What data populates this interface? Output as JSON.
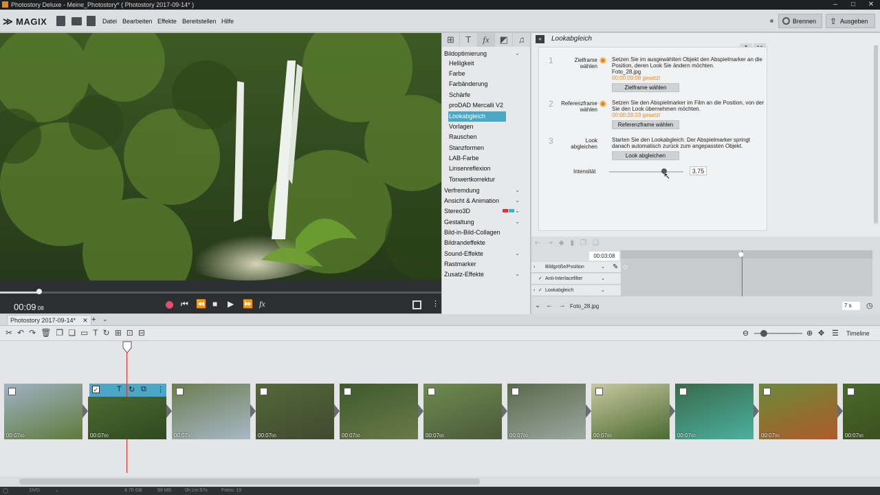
{
  "window": {
    "title": "Photostory Deluxe - Meine_Photostory* ( Photostory 2017-09-14* )",
    "min": "–",
    "max": "□",
    "close": "✕"
  },
  "menu": {
    "brand": "MAGIX",
    "items": [
      "Datei",
      "Bearbeiten",
      "Effekte",
      "Bereitstellen",
      "Hilfe"
    ],
    "burn_label": "Brennen",
    "export_label": "Ausgeben"
  },
  "preview": {
    "timecode": "00:09",
    "timecode_frames": "08"
  },
  "effects": {
    "tabs": [
      "⊞",
      "T",
      "fx",
      "◩",
      "♫"
    ],
    "categories": [
      {
        "label": "Bildoptimierung",
        "expanded": true,
        "children": [
          "Helligkeit",
          "Farbe",
          "Farbänderung",
          "Schärfe",
          "proDAD Mercalli V2",
          "Lookabgleich",
          "Vorlagen",
          "Rauschen",
          "Stanzformen",
          "LAB-Farbe",
          "Linsenreflexion",
          "Tonwertkorrektur"
        ]
      },
      {
        "label": "Verfremdung"
      },
      {
        "label": "Ansicht & Animation"
      },
      {
        "label": "Stereo3D"
      },
      {
        "label": "Gestaltung"
      },
      {
        "label": "Bild-in-Bild-Collagen"
      },
      {
        "label": "Bildrandeffekte"
      },
      {
        "label": "Sound-Effekte"
      },
      {
        "label": "Rastmarker"
      },
      {
        "label": "Zusatz-Effekte"
      }
    ],
    "selected": "Lookabgleich"
  },
  "lookabgleich": {
    "title": "Lookabgleich",
    "step1": {
      "num": "1",
      "label1": "Zielframe",
      "label2": "wählen",
      "text": "Setzen Sie im ausgewählten Objekt den Abspielmarker an die Position, deren Look Sie ändern möchten.",
      "file": "Foto_28.jpg",
      "time": "00:00:09:08",
      "set": "gesetzt",
      "button": "Zielframe wählen"
    },
    "step2": {
      "num": "2",
      "label1": "Referenzframe",
      "label2": "wählen",
      "text": "Setzen Sie den Abspielmarker im Film an die Position, von der Sie den Look übernehmen möchten.",
      "time": "00:00:28:23",
      "set": "gesetzt",
      "button": "Referenzframe wählen"
    },
    "step3": {
      "num": "3",
      "label1": "Look",
      "label2": "abgleichen",
      "text": "Starten Sie den Lookabgleich. Der Abspielmarker springt danach automatisch zurück zum angepassten Objekt.",
      "button": "Look abgleichen"
    },
    "intensity_label": "Intensität",
    "intensity_value": "3.75",
    "intensity_fraction": 0.74
  },
  "keyframes": {
    "time": "00:03:08",
    "rows": [
      "Bildgröße/Position",
      "Anti-Interlacefilter",
      "Lookabgleich"
    ],
    "file": "Foto_28.jpg",
    "duration": "7 s"
  },
  "timeline": {
    "tab": "Photostory 2017-09-14*",
    "add": "+",
    "view_label": "Timeline",
    "clips": [
      {
        "dur": "00:07",
        "frames": "00",
        "colors": [
          "#9fb3c4",
          "#5f7a3a"
        ]
      },
      {
        "dur": "00:07",
        "frames": "00",
        "colors": [
          "#4b6a32",
          "#2f4a1f"
        ]
      },
      {
        "dur": "00:07",
        "frames": "00",
        "colors": [
          "#6b7d4f",
          "#a8b8c8"
        ]
      },
      {
        "dur": "00:07",
        "frames": "00",
        "colors": [
          "#55683a",
          "#3f4a30"
        ]
      },
      {
        "dur": "00:07",
        "frames": "00",
        "colors": [
          "#3f5a2a",
          "#6a7a4a"
        ]
      },
      {
        "dur": "00:07",
        "frames": "00",
        "colors": [
          "#6f8a4f",
          "#4a5a3a"
        ]
      },
      {
        "dur": "00:07",
        "frames": "00",
        "colors": [
          "#5a6a4a",
          "#9aa8a0"
        ]
      },
      {
        "dur": "00:07",
        "frames": "00",
        "colors": [
          "#c8c8a0",
          "#4a6a30"
        ]
      },
      {
        "dur": "00:07",
        "frames": "00",
        "colors": [
          "#3a6a4a",
          "#4ab0a0"
        ]
      },
      {
        "dur": "00:07",
        "frames": "00",
        "colors": [
          "#6a8a3a",
          "#b05a2a"
        ]
      },
      {
        "dur": "00:07",
        "frames": "00",
        "colors": [
          "#4a6a2a",
          "#3a4a20"
        ]
      }
    ]
  },
  "status": {
    "disc": "DVD",
    "size": "4.70 GB",
    "mem": "99 MB",
    "duration": "0h:1m:57s",
    "photos": "Fotos: 19"
  }
}
